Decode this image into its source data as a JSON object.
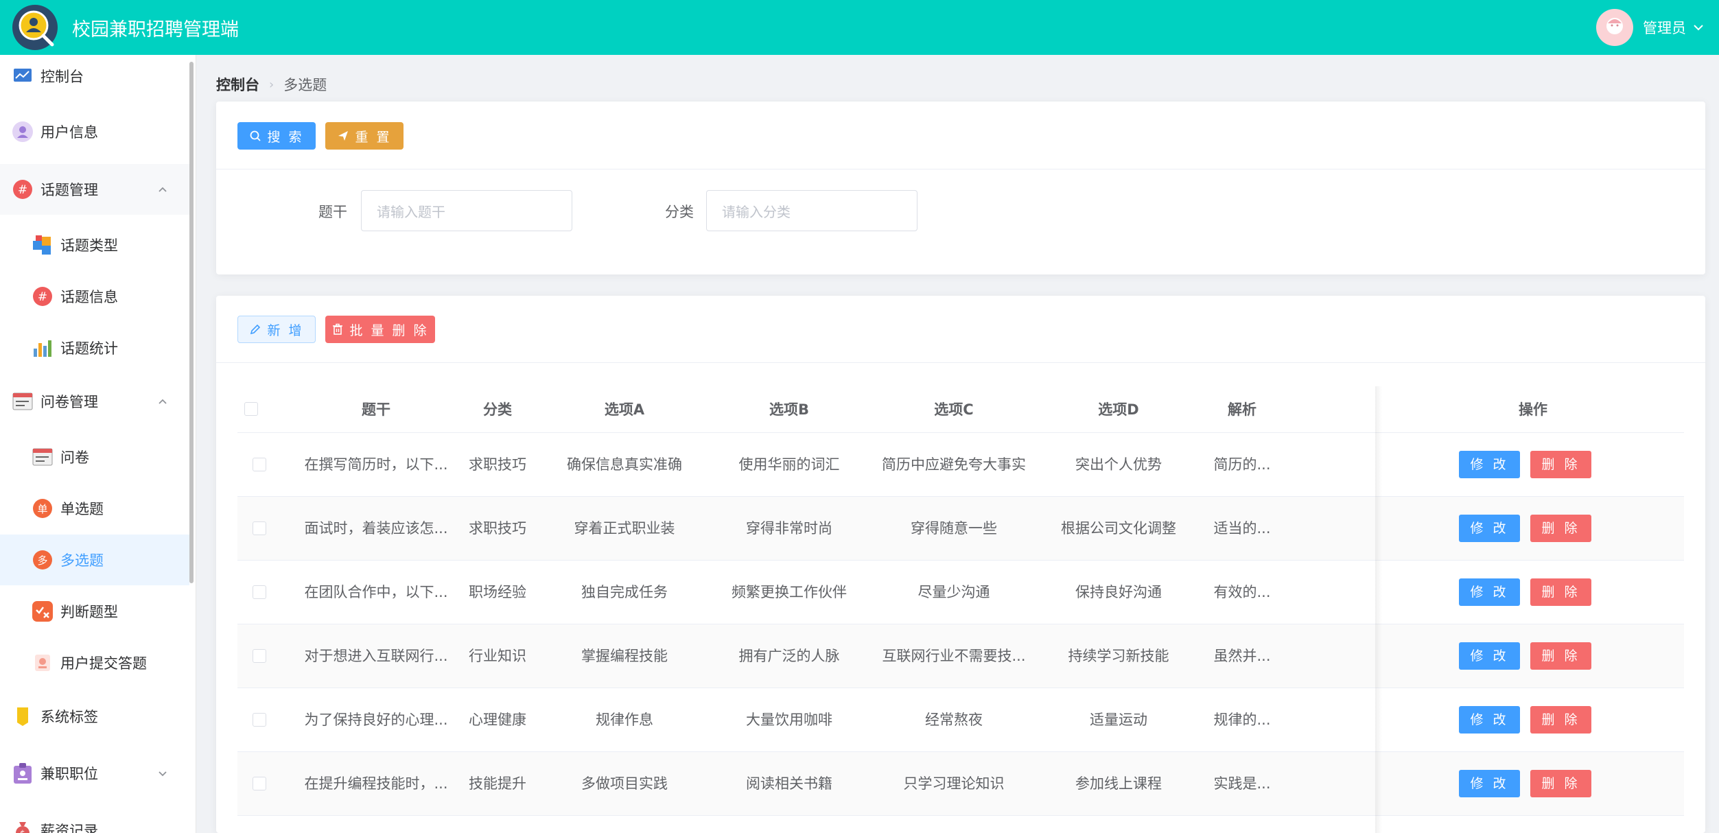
{
  "header": {
    "app_title": "校园兼职招聘管理端",
    "admin_name": "管理员"
  },
  "sidebar": {
    "items": [
      {
        "label": "控制台",
        "icon": "chart-line-icon",
        "level": "top"
      },
      {
        "label": "用户信息",
        "icon": "user-icon",
        "level": "top"
      },
      {
        "label": "话题管理",
        "icon": "hashtag-icon",
        "level": "top",
        "expanded": true
      },
      {
        "label": "话题类型",
        "icon": "blocks-icon",
        "level": "sub"
      },
      {
        "label": "话题信息",
        "icon": "hashtag-icon",
        "level": "sub"
      },
      {
        "label": "话题统计",
        "icon": "bar-chart-icon",
        "level": "sub"
      },
      {
        "label": "问卷管理",
        "icon": "form-icon",
        "level": "top",
        "expanded": true
      },
      {
        "label": "问卷",
        "icon": "form-icon",
        "level": "sub"
      },
      {
        "label": "单选题",
        "icon": "single-choice-icon",
        "icon_text": "单",
        "level": "sub"
      },
      {
        "label": "多选题",
        "icon": "multi-choice-icon",
        "icon_text": "多",
        "level": "sub",
        "active": true
      },
      {
        "label": "判断题型",
        "icon": "judge-icon",
        "level": "sub"
      },
      {
        "label": "用户提交答题",
        "icon": "submit-icon",
        "level": "sub"
      },
      {
        "label": "系统标签",
        "icon": "tag-icon",
        "level": "top"
      },
      {
        "label": "兼职职位",
        "icon": "badge-icon",
        "level": "top",
        "expanded": false
      },
      {
        "label": "薪资记录",
        "icon": "money-bag-icon",
        "level": "top"
      }
    ]
  },
  "breadcrumb": {
    "root": "控制台",
    "current": "多选题"
  },
  "search": {
    "search_label": "搜 索",
    "reset_label": "重 置",
    "field_stem_label": "题干",
    "field_stem_placeholder": "请输入题干",
    "field_category_label": "分类",
    "field_category_placeholder": "请输入分类"
  },
  "toolbar": {
    "add_label": "新 增",
    "batch_delete_label": "批 量 删 除"
  },
  "table": {
    "columns": [
      "题干",
      "分类",
      "选项A",
      "选项B",
      "选项C",
      "选项D",
      "解析",
      "操作"
    ],
    "edit_label": "修 改",
    "delete_label": "删 除",
    "rows": [
      [
        "在撰写简历时，以下...",
        "求职技巧",
        "确保信息真实准确",
        "使用华丽的词汇",
        "简历中应避免夸大事实",
        "突出个人优势",
        "简历的..."
      ],
      [
        "面试时，着装应该怎...",
        "求职技巧",
        "穿着正式职业装",
        "穿得非常时尚",
        "穿得随意一些",
        "根据公司文化调整",
        "适当的..."
      ],
      [
        "在团队合作中，以下...",
        "职场经验",
        "独自完成任务",
        "频繁更换工作伙伴",
        "尽量少沟通",
        "保持良好沟通",
        "有效的..."
      ],
      [
        "对于想进入互联网行...",
        "行业知识",
        "掌握编程技能",
        "拥有广泛的人脉",
        "互联网行业不需要技...",
        "持续学习新技能",
        "虽然并..."
      ],
      [
        "为了保持良好的心理...",
        "心理健康",
        "规律作息",
        "大量饮用咖啡",
        "经常熬夜",
        "适量运动",
        "规律的..."
      ],
      [
        "在提升编程技能时，...",
        "技能提升",
        "多做项目实践",
        "阅读相关书籍",
        "只学习理论知识",
        "参加线上课程",
        "实践是..."
      ]
    ]
  },
  "colors": {
    "header_bg": "#00d1c1",
    "primary": "#409eff",
    "warning": "#e6a23c",
    "danger": "#f56c6c"
  }
}
